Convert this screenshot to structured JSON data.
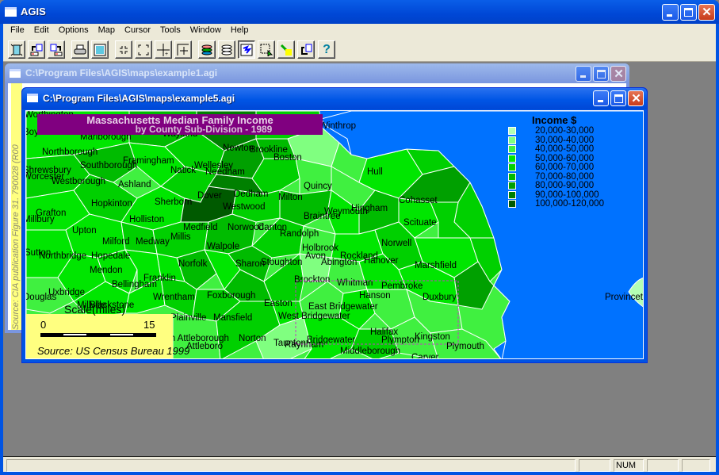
{
  "app": {
    "title": "AGIS"
  },
  "menu": [
    "File",
    "Edit",
    "Options",
    "Map",
    "Cursor",
    "Tools",
    "Window",
    "Help"
  ],
  "toolbar": {
    "buttons": [
      {
        "name": "new-map",
        "icon": "new-document-icon"
      },
      {
        "name": "open-map",
        "icon": "open-arrow-icon"
      },
      {
        "name": "save-map",
        "icon": "save-arrow-icon"
      },
      {
        "name": "print",
        "icon": "printer-icon"
      },
      {
        "name": "page-layout",
        "icon": "page-icon"
      },
      {
        "name": "zoom-in",
        "icon": "zoom-in-corners-icon"
      },
      {
        "name": "zoom-out",
        "icon": "zoom-out-corners-icon"
      },
      {
        "name": "pan",
        "icon": "crosshair-icon"
      },
      {
        "name": "measure",
        "icon": "ruler-icon"
      },
      {
        "name": "layers",
        "icon": "layers-color-icon"
      },
      {
        "name": "layers-outline",
        "icon": "layers-outline-icon"
      },
      {
        "name": "map-view",
        "icon": "map-view-icon",
        "pressed": true
      },
      {
        "name": "select-region",
        "icon": "select-region-icon"
      },
      {
        "name": "highlight",
        "icon": "highlighter-icon"
      },
      {
        "name": "redraw",
        "icon": "redraw-icon"
      },
      {
        "name": "help",
        "icon": "help-icon",
        "glyph": "?"
      }
    ]
  },
  "windows": {
    "back": {
      "title": "C:\\Program Files\\AGIS\\maps\\example1.agi",
      "side_text": "Source: CIA publication Figure 31. 790028 (R00"
    },
    "front": {
      "title": "C:\\Program Files\\AGIS\\maps\\example5.agi"
    }
  },
  "map": {
    "title": "Massachusetts Median Family Income",
    "subtitle": "by County Sub-Division - 1989",
    "source": "Source: US Census Bureau 1999",
    "colors": {
      "water": "#0072ff",
      "border": "#ffffff",
      "scale_box": "#ffff80",
      "title_box": "#800080"
    },
    "scale": {
      "title": "Scale(miles)",
      "min": "0",
      "max": "15"
    },
    "legend": {
      "title": "Income $",
      "items": [
        {
          "label": "20,000-30,000",
          "color": "#b4ffb4"
        },
        {
          "label": "30,000-40,000",
          "color": "#80ff80"
        },
        {
          "label": "40,000-50,000",
          "color": "#40f040"
        },
        {
          "label": "50,000-60,000",
          "color": "#00e600"
        },
        {
          "label": "60,000-70,000",
          "color": "#00d000"
        },
        {
          "label": "70,000-80,000",
          "color": "#00bb00"
        },
        {
          "label": "80,000-90,000",
          "color": "#00a000"
        },
        {
          "label": "90,000-100,000",
          "color": "#008000"
        },
        {
          "label": "100,000-120,000",
          "color": "#005a00"
        }
      ]
    },
    "towns": [
      "Worthington",
      "Boylston",
      "Marlborough",
      "Wayland",
      "Newton",
      "Brookline",
      "Boston",
      "Winthrop",
      "Northborough",
      "Framingham",
      "Wellesley",
      "Needham",
      "Natick",
      "Southborough",
      "Shrewsbury",
      "Worcester",
      "Westborough",
      "Ashland",
      "Sherborn",
      "Dover",
      "Dedham",
      "Milton",
      "Quincy",
      "Hull",
      "Cohasset",
      "Hopkinton",
      "Westwood",
      "Braintree",
      "Weymouth",
      "Hingham",
      "Grafton",
      "Millbury",
      "Holliston",
      "Medfield",
      "Norwood",
      "Canton",
      "Randolph",
      "Scituate",
      "Upton",
      "Milford",
      "Medway",
      "Millis",
      "Walpole",
      "Holbrook",
      "Avon",
      "Rockland",
      "Norwell",
      "Sutton",
      "Northbridge",
      "Hopedale",
      "Norfolk",
      "Sharon",
      "Stoughton",
      "Abington",
      "Hanover",
      "Marshfield",
      "Mendon",
      "Franklin",
      "Bellingham",
      "Brockton",
      "Whitman",
      "Pembroke",
      "Duxbury",
      "Uxbridge",
      "Douglas",
      "Millville",
      "Blackstone",
      "Wrentham",
      "Foxborough",
      "Easton",
      "East Bridgewater",
      "Hanson",
      "West Bridgewater",
      "Plainville",
      "Mansfield",
      "Halifax",
      "Kingston",
      "North Attleborough",
      "Norton",
      "Taunton",
      "Raynham",
      "Bridgewater",
      "Plympton",
      "Attleboro",
      "Middleborough",
      "Carver",
      "Plymouth",
      "Provincetown"
    ]
  },
  "statusbar": {
    "panes": [
      "",
      "",
      "NUM",
      "",
      ""
    ]
  }
}
